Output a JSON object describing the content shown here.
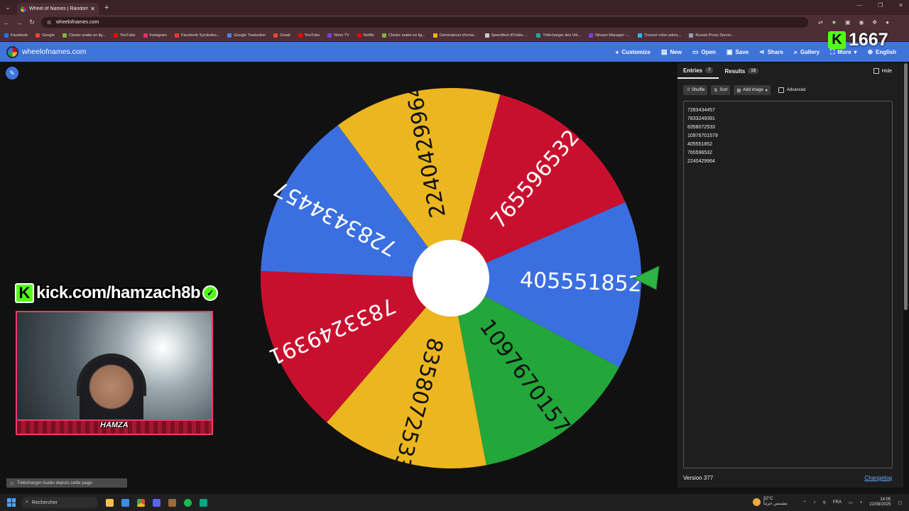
{
  "browser": {
    "tab_title": "Wheel of Names | Random nam",
    "url": "wheelofnames.com",
    "bookmarks": [
      {
        "label": "Facebook",
        "color": "#1877f2"
      },
      {
        "label": "Google",
        "color": "#ea4335"
      },
      {
        "label": "Clavier arabe en lig...",
        "color": "#7cb342"
      },
      {
        "label": "YouTube",
        "color": "#ff0000"
      },
      {
        "label": "Instagram",
        "color": "#e1306c"
      },
      {
        "label": "Facebook Symboles...",
        "color": "#e53935"
      },
      {
        "label": "Google Traduction",
        "color": "#4285f4"
      },
      {
        "label": "Gmail",
        "color": "#ea4335"
      },
      {
        "label": "YouTube",
        "color": "#ff0000"
      },
      {
        "label": "Nimo TV",
        "color": "#7b3fe4"
      },
      {
        "label": "Netflix",
        "color": "#e50914"
      },
      {
        "label": "Clavier arabe en lig...",
        "color": "#7cb342"
      },
      {
        "label": "Générateurs d'emai...",
        "color": "#f4b400"
      },
      {
        "label": "Speedtest d'Ookla -...",
        "color": "#cccccc"
      },
      {
        "label": "Télécharger des Vid...",
        "color": "#26a69a"
      },
      {
        "label": "Stream Manager -...",
        "color": "#7b3fe4"
      },
      {
        "label": "Trouver votre adres...",
        "color": "#29b6f6"
      },
      {
        "label": "Russia Proxy Server...",
        "color": "#90a4ae"
      }
    ]
  },
  "site": {
    "name": "wheelofnames.com",
    "menu": [
      {
        "label": "Customize",
        "icon": "palette-icon",
        "glyph": "◕"
      },
      {
        "label": "New",
        "icon": "file-icon",
        "glyph": "▤"
      },
      {
        "label": "Open",
        "icon": "folder-icon",
        "glyph": "▭"
      },
      {
        "label": "Save",
        "icon": "save-icon",
        "glyph": "▣"
      },
      {
        "label": "Share",
        "icon": "share-icon",
        "glyph": "⋖"
      },
      {
        "label": "Gallery",
        "icon": "search-icon",
        "glyph": "⌕"
      },
      {
        "label": "More",
        "icon": "fullscreen-icon",
        "glyph": "⛶"
      },
      {
        "label": "English",
        "icon": "globe-icon",
        "glyph": "⊕"
      }
    ]
  },
  "wheel": {
    "segments": [
      {
        "label": "765596532",
        "color": "#c8102e",
        "text_color": "#ffffff"
      },
      {
        "label": "405551852",
        "color": "#3b6fe0",
        "text_color": "#ffffff"
      },
      {
        "label": "10976701579",
        "color": "#23a63a",
        "text_color": "#111111"
      },
      {
        "label": "8358072533",
        "color": "#ebb620",
        "text_color": "#111111"
      },
      {
        "label": "7833249391",
        "color": "#c8102e",
        "text_color": "#ffffff"
      },
      {
        "label": "7283434457",
        "color": "#3b6fe0",
        "text_color": "#ffffff"
      },
      {
        "label": "2240429964",
        "color": "#ebb620",
        "text_color": "#111111"
      }
    ]
  },
  "panel": {
    "tab_entries": "Entries",
    "entries_count": "7",
    "tab_results": "Results",
    "results_count": "18",
    "hide_label": "Hide",
    "shuffle_label": "Shuffle",
    "sort_label": "Sort",
    "add_image_label": "Add image",
    "advanced_label": "Advanced",
    "entries": [
      "7283434457",
      "7833249391",
      "8358072533",
      "10976701579",
      "405551852",
      "765596532",
      "2240429964"
    ],
    "version": "Version 377",
    "changelog": "Changelog"
  },
  "overlay": {
    "kick_count": "1667",
    "kick_url": "kick.com/hamzach8b",
    "streamer_tag": "HAMZA",
    "download_audio": "Télécharger Audio depuis cette page"
  },
  "taskbar": {
    "search_placeholder": "Rechercher",
    "temperature": "32°C",
    "weather_desc": "مشمس جزئياً",
    "language": "FRA",
    "time": "14:05",
    "date": "22/08/2025"
  }
}
